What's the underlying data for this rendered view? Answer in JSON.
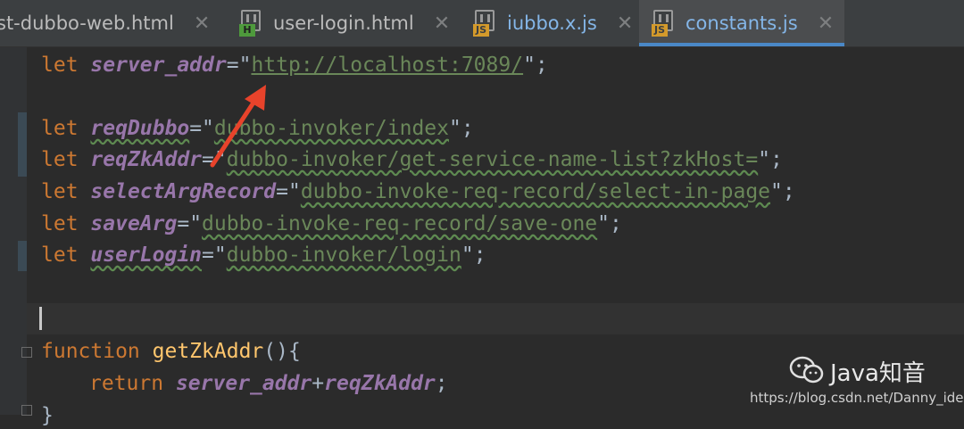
{
  "tabs": [
    {
      "label": "st-dubbo-web.html",
      "icon": "html-file-icon",
      "active": false
    },
    {
      "label": "user-login.html",
      "icon": "html-file-icon",
      "badge": "H",
      "active": false
    },
    {
      "label": "iubbo.x.js",
      "icon": "js-file-icon",
      "badge": "JS",
      "active": false
    },
    {
      "label": "constants.js",
      "icon": "js-file-icon",
      "badge": "JS",
      "active": true
    }
  ],
  "code": {
    "line1": {
      "kw": "let",
      "var": "server_addr",
      "eq": "=\"",
      "url": "http://localhost:7089/",
      "end": "\";"
    },
    "line3": {
      "kw": "let",
      "var": "reqDubbo",
      "eq": "=\"",
      "str": "dubbo-invoker/index",
      "end": "\";"
    },
    "line4": {
      "kw": "let",
      "var": "reqZkAddr",
      "eq": "=\"",
      "str": "dubbo-invoker/get-service-name-list?zkHost=",
      "end": "\";"
    },
    "line5": {
      "kw": "let",
      "var": "selectArgRecord",
      "eq": "=\"",
      "str": "dubbo-invoke-req-record/select-in-page",
      "end": "\";"
    },
    "line6": {
      "kw": "let",
      "var": "saveArg",
      "eq": "=\"",
      "str": "dubbo-invoke-req-record/save-one",
      "end": "\";"
    },
    "line7": {
      "kw": "let",
      "var": "userLogin",
      "eq": "=\"",
      "str": "dubbo-invoker/login",
      "end": "\";"
    },
    "line10": {
      "kw": "function",
      "fn": "getZkAddr",
      "rest": "(){"
    },
    "line11": {
      "kw": "return",
      "var1": "server_addr",
      "plus": "+",
      "var2": "reqZkAddr",
      "end": ";"
    },
    "line12": {
      "text": "}"
    }
  },
  "watermark": {
    "brand": "Java知音",
    "url": "https://blog.csdn.net/Danny_idea"
  },
  "colors": {
    "keyword": "#cc7832",
    "variable": "#9876aa",
    "string": "#6a8759",
    "function": "#ffc66d",
    "arrow": "#e8432b"
  }
}
